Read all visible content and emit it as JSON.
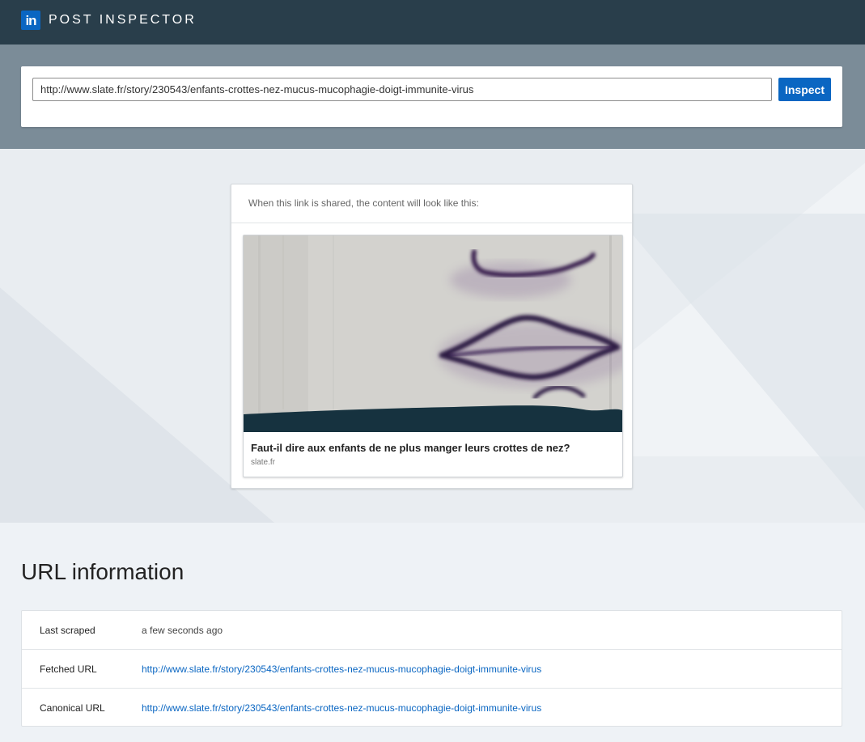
{
  "header": {
    "logo_text": "in",
    "title": "POST INSPECTOR"
  },
  "search": {
    "value": "http://www.slate.fr/story/230543/enfants-crottes-nez-mucus-mucophagie-doigt-immunite-virus",
    "button_label": "Inspect"
  },
  "preview": {
    "caption": "When this link is shared, the content will look like this:",
    "title": "Faut-il dire aux enfants de ne plus manger leurs crottes de nez?",
    "domain": "slate.fr"
  },
  "url_info": {
    "heading": "URL information",
    "rows": [
      {
        "label": "Last scraped",
        "value": "a few seconds ago"
      },
      {
        "label": "Fetched URL",
        "value": "http://www.slate.fr/story/230543/enfants-crottes-nez-mucus-mucophagie-doigt-immunite-virus"
      },
      {
        "label": "Canonical URL",
        "value": "http://www.slate.fr/story/230543/enfants-crottes-nez-mucus-mucophagie-doigt-immunite-virus"
      }
    ]
  },
  "colors": {
    "brand": "#0a66c2",
    "header_bg": "#293e4b",
    "band_bg": "#7b8c98"
  }
}
